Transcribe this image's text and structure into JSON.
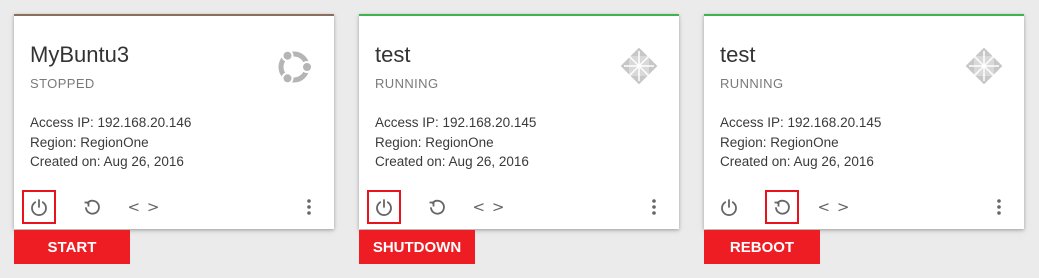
{
  "colors": {
    "stopped_bar": "#8a6d5a",
    "running_bar": "#3fb34f",
    "highlight": "#e8141b",
    "label_bg": "#ee1d23"
  },
  "instances": [
    {
      "name": "MyBuntu3",
      "status": "STOPPED",
      "access_ip": "Access IP: 192.168.20.146",
      "region": "Region: RegionOne",
      "created": "Created on: Aug 26, 2016",
      "os_icon": "ubuntu-logo-icon",
      "highlighted_action": "power",
      "caption": "START"
    },
    {
      "name": "test",
      "status": "RUNNING",
      "access_ip": "Access IP: 192.168.20.145",
      "region": "Region: RegionOne",
      "created": "Created on: Aug 26, 2016",
      "os_icon": "centos-logo-icon",
      "highlighted_action": "power",
      "caption": "SHUTDOWN"
    },
    {
      "name": "test",
      "status": "RUNNING",
      "access_ip": "Access IP: 192.168.20.145",
      "region": "Region: RegionOne",
      "created": "Created on: Aug 26, 2016",
      "os_icon": "centos-logo-icon",
      "highlighted_action": "restart",
      "caption": "REBOOT"
    }
  ],
  "actions": {
    "power_icon": "power-icon",
    "restart_icon": "restart-icon",
    "console_icon": "code-icon",
    "console_glyph": "< >",
    "more_icon": "more-vertical-icon"
  }
}
